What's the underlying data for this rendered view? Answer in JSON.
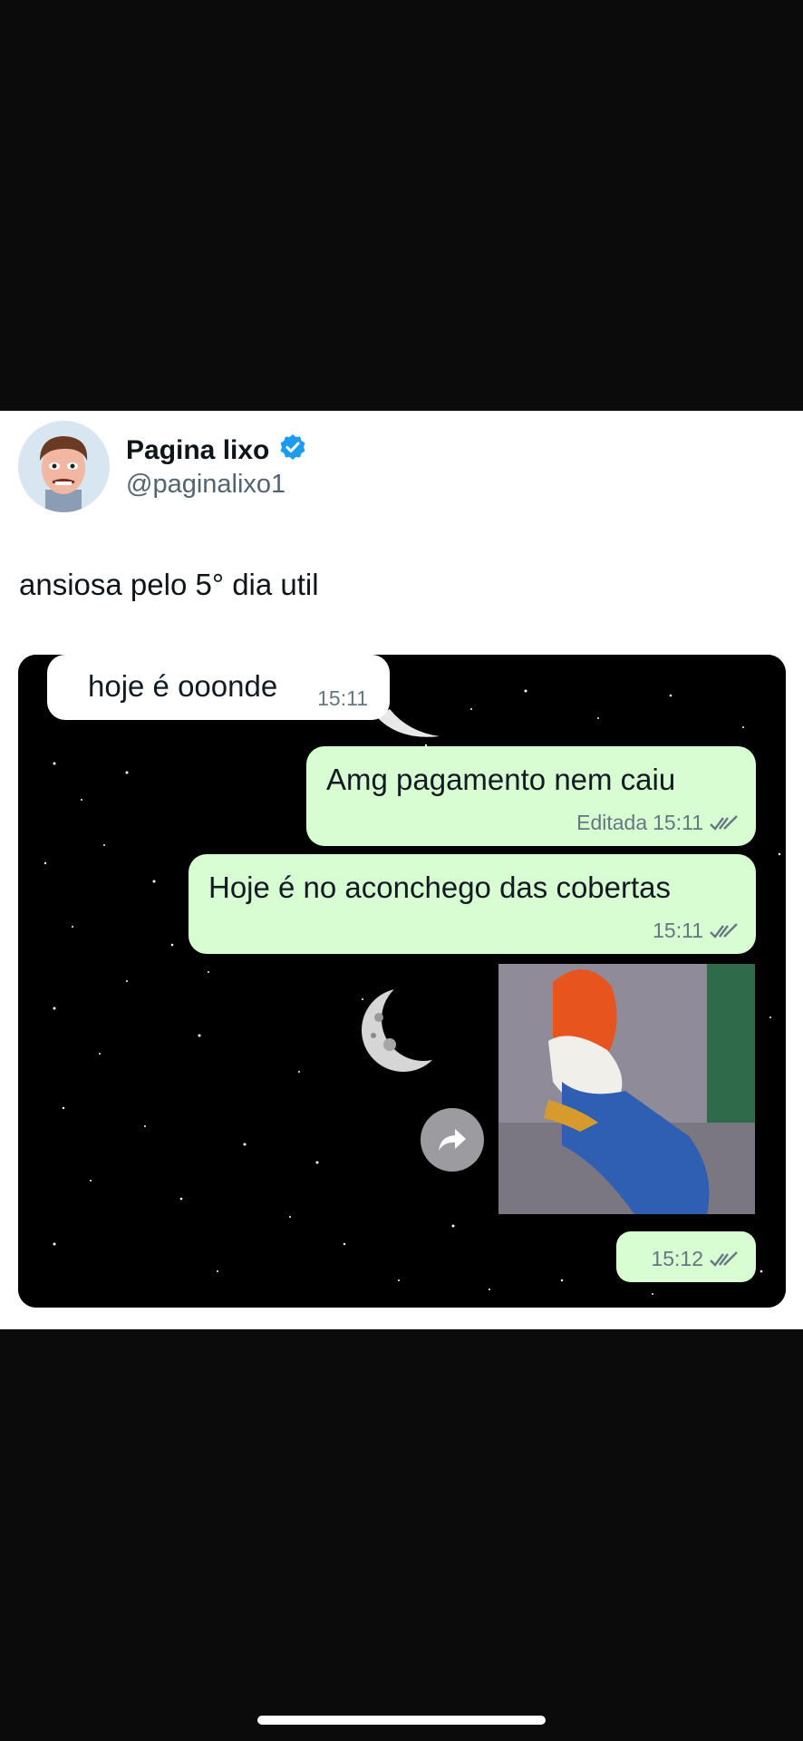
{
  "tweet": {
    "author_name": "Pagina lixo",
    "handle": "@paginalixo1",
    "text": "ansiosa pelo 5° dia util",
    "verified": true,
    "verified_color": "#1d9bf0"
  },
  "chat": {
    "messages": [
      {
        "direction": "incoming",
        "text": "hoje é ooonde",
        "time": "15:11"
      },
      {
        "direction": "outgoing",
        "text": "Amg pagamento nem caiu",
        "edited_label": "Editada",
        "time": "15:11",
        "status": "read-ticks"
      },
      {
        "direction": "outgoing",
        "text": "Hoje é no aconchego das cobertas",
        "time": "15:11",
        "status": "read-ticks"
      },
      {
        "direction": "outgoing",
        "type": "image",
        "time": "15:12",
        "status": "read-ticks"
      }
    ],
    "forward_icon": "forward-arrow-icon",
    "outgoing_color": "#d9fdd3",
    "incoming_color": "#ffffff"
  }
}
